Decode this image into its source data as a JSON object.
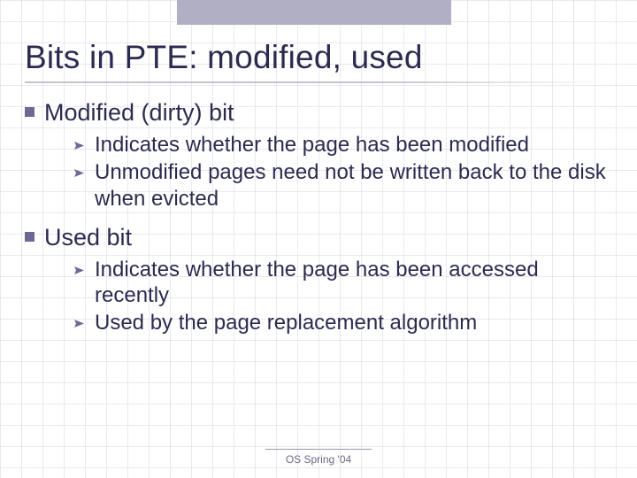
{
  "slide": {
    "title": "Bits in PTE: modified, used",
    "sections": [
      {
        "label": "Modified (dirty) bit",
        "items": [
          "Indicates whether the page has been modified",
          "Unmodified pages need not be written back to the disk when evicted"
        ]
      },
      {
        "label": "Used bit",
        "items": [
          "Indicates whether the page has been accessed recently",
          "Used by the page replacement algorithm"
        ]
      }
    ],
    "footer": "OS Spring '04"
  }
}
